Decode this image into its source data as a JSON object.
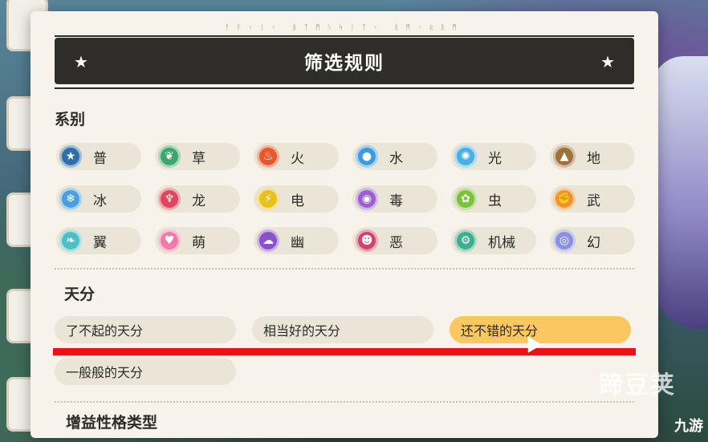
{
  "header": {
    "rune_text": "ᚨᚹᚲᛁᚲ ᛒᛏᛗᛊᛋᛁᛏᚲ ᚱᛗᚲᛟᚱᛗ",
    "title": "筛选规则"
  },
  "type_section": {
    "heading": "系别",
    "types": [
      {
        "label": "普",
        "icon": "star-icon",
        "glyph": "★",
        "color": "#2f6ea8"
      },
      {
        "label": "草",
        "icon": "leaf-icon",
        "glyph": "❦",
        "color": "#3da66b"
      },
      {
        "label": "火",
        "icon": "flame-icon",
        "glyph": "♨",
        "color": "#e5592b"
      },
      {
        "label": "水",
        "icon": "water-drop-icon",
        "glyph": "●",
        "color": "#3b9be0"
      },
      {
        "label": "光",
        "icon": "sun-icon",
        "glyph": "✺",
        "color": "#47b0e8"
      },
      {
        "label": "地",
        "icon": "mountain-icon",
        "glyph": "▲",
        "color": "#a0723b"
      },
      {
        "label": "冰",
        "icon": "snowflake-icon",
        "glyph": "❄",
        "color": "#4aa0df"
      },
      {
        "label": "龙",
        "icon": "dragon-icon",
        "glyph": "♆",
        "color": "#e0465a"
      },
      {
        "label": "电",
        "icon": "lightning-icon",
        "glyph": "⚡",
        "color": "#e8c21c"
      },
      {
        "label": "毒",
        "icon": "poison-icon",
        "glyph": "◉",
        "color": "#9b5fd0"
      },
      {
        "label": "虫",
        "icon": "bug-icon",
        "glyph": "✿",
        "color": "#7cc23a"
      },
      {
        "label": "武",
        "icon": "fist-icon",
        "glyph": "✊",
        "color": "#f0932e"
      },
      {
        "label": "翼",
        "icon": "wing-icon",
        "glyph": "❧",
        "color": "#4cc0c6"
      },
      {
        "label": "萌",
        "icon": "heart-icon",
        "glyph": "♥",
        "color": "#ef7aa8"
      },
      {
        "label": "幽",
        "icon": "ghost-icon",
        "glyph": "☁",
        "color": "#8a52c8"
      },
      {
        "label": "恶",
        "icon": "demon-icon",
        "glyph": "☻",
        "color": "#d0436a"
      },
      {
        "label": "机械",
        "icon": "gear-icon",
        "glyph": "⚙",
        "color": "#3fae8c"
      },
      {
        "label": "幻",
        "icon": "spiral-icon",
        "glyph": "◎",
        "color": "#8b8fe0"
      }
    ]
  },
  "talent_section": {
    "heading": "天分",
    "options": [
      {
        "label": "了不起的天分",
        "selected": false
      },
      {
        "label": "相当好的天分",
        "selected": false
      },
      {
        "label": "还不错的天分",
        "selected": true
      },
      {
        "label": "一般般的天分",
        "selected": false
      }
    ]
  },
  "next_section": {
    "heading": "增益性格类型"
  },
  "watermark": {
    "main": "蹄豆荚",
    "brand": "九游"
  },
  "colors": {
    "title_bg": "#2f2d2a",
    "selected": "#fbc760",
    "chip_bg": "#ebe5d8",
    "annotation": "#ee1111"
  }
}
